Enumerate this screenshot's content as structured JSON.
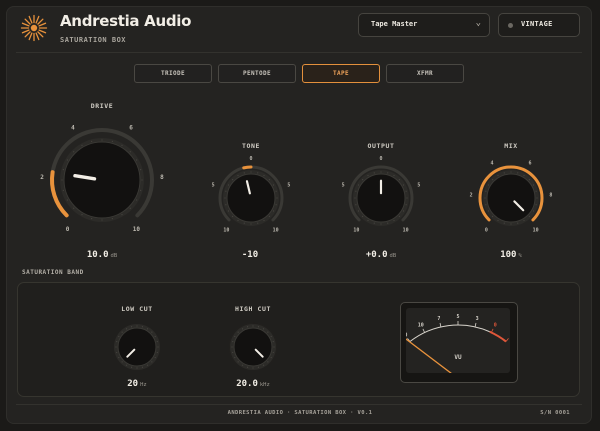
{
  "header": {
    "brand": "Andrestia Audio",
    "subtitle": "SATURATION BOX",
    "preset": "Tape Master",
    "vintage_label": "VINTAGE"
  },
  "modes": {
    "items": [
      "TRIODE",
      "PENTODE",
      "TAPE",
      "XFMR"
    ],
    "selected": "TAPE"
  },
  "knobs": {
    "drive": {
      "label": "DRIVE",
      "value_text": "10.0",
      "unit": "dB",
      "ticks": [
        "0",
        "2",
        "4",
        "6",
        "8",
        "10"
      ],
      "position": 0.2
    },
    "tone": {
      "label": "TONE",
      "value_text": "-10",
      "unit": "",
      "ticks": [
        "10",
        "5",
        "0",
        "5",
        "10"
      ],
      "position": 0.45
    },
    "output": {
      "label": "OUTPUT",
      "value_text": "+0.0",
      "unit": "dB",
      "ticks": [
        "10",
        "5",
        "0",
        "5",
        "10"
      ],
      "position": 0.5
    },
    "mix": {
      "label": "MIX",
      "value_text": "100",
      "unit": "%",
      "ticks": [
        "0",
        "2",
        "4",
        "6",
        "8",
        "10"
      ],
      "position": 1.0
    }
  },
  "band": {
    "section_label": "SATURATION BAND",
    "low_cut": {
      "label": "LOW CUT",
      "value_text": "20",
      "unit": "Hz",
      "position": 0.0
    },
    "high_cut": {
      "label": "HIGH CUT",
      "value_text": "20.0",
      "unit": "kHz",
      "position": 1.0
    }
  },
  "vu": {
    "label": "VU",
    "scale": [
      "20",
      "10",
      "7",
      "5",
      "3",
      "0",
      "3"
    ],
    "level_fraction": 0.1
  },
  "footer": {
    "text": "ANDRESTIA AUDIO · SATURATION BOX · V0.1",
    "serial": "S/N 0001"
  },
  "colors": {
    "accent": "#e8923c",
    "background": "#242321",
    "knob_body": "#141312",
    "text": "#f2eee6"
  }
}
